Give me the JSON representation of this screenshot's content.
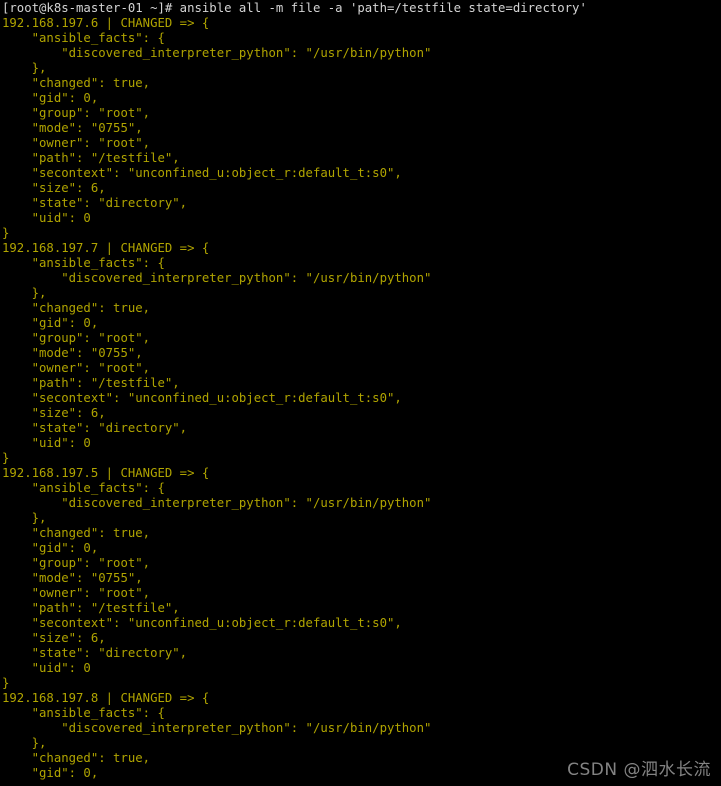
{
  "terminal": {
    "title": "root@k8s-master-01:~",
    "background_color": "#000000",
    "prompt_color": "#d4d4d4",
    "output_color": "#b0a400",
    "prompt_line": "[root@k8s-master-01 ~]# ansible all -m file -a 'path=/testfile state=directory'",
    "prompt": "[root@k8s-master-01 ~]#",
    "command": "ansible all -m file -a 'path=/testfile state=directory'",
    "lines": [
      {
        "text": "[root@k8s-master-01 ~]# ansible all -m file -a 'path=/testfile state=directory'",
        "kind": "prompt"
      },
      {
        "text": "192.168.197.6 | CHANGED => {",
        "kind": "out"
      },
      {
        "text": "    \"ansible_facts\": {",
        "kind": "out"
      },
      {
        "text": "        \"discovered_interpreter_python\": \"/usr/bin/python\"",
        "kind": "out"
      },
      {
        "text": "    },",
        "kind": "out"
      },
      {
        "text": "    \"changed\": true,",
        "kind": "out"
      },
      {
        "text": "    \"gid\": 0,",
        "kind": "out"
      },
      {
        "text": "    \"group\": \"root\",",
        "kind": "out"
      },
      {
        "text": "    \"mode\": \"0755\",",
        "kind": "out"
      },
      {
        "text": "    \"owner\": \"root\",",
        "kind": "out"
      },
      {
        "text": "    \"path\": \"/testfile\",",
        "kind": "out"
      },
      {
        "text": "    \"secontext\": \"unconfined_u:object_r:default_t:s0\",",
        "kind": "out"
      },
      {
        "text": "    \"size\": 6,",
        "kind": "out"
      },
      {
        "text": "    \"state\": \"directory\",",
        "kind": "out"
      },
      {
        "text": "    \"uid\": 0",
        "kind": "out"
      },
      {
        "text": "}",
        "kind": "out"
      },
      {
        "text": "192.168.197.7 | CHANGED => {",
        "kind": "out"
      },
      {
        "text": "    \"ansible_facts\": {",
        "kind": "out"
      },
      {
        "text": "        \"discovered_interpreter_python\": \"/usr/bin/python\"",
        "kind": "out"
      },
      {
        "text": "    },",
        "kind": "out"
      },
      {
        "text": "    \"changed\": true,",
        "kind": "out"
      },
      {
        "text": "    \"gid\": 0,",
        "kind": "out"
      },
      {
        "text": "    \"group\": \"root\",",
        "kind": "out"
      },
      {
        "text": "    \"mode\": \"0755\",",
        "kind": "out"
      },
      {
        "text": "    \"owner\": \"root\",",
        "kind": "out"
      },
      {
        "text": "    \"path\": \"/testfile\",",
        "kind": "out"
      },
      {
        "text": "    \"secontext\": \"unconfined_u:object_r:default_t:s0\",",
        "kind": "out"
      },
      {
        "text": "    \"size\": 6,",
        "kind": "out"
      },
      {
        "text": "    \"state\": \"directory\",",
        "kind": "out"
      },
      {
        "text": "    \"uid\": 0",
        "kind": "out"
      },
      {
        "text": "}",
        "kind": "out"
      },
      {
        "text": "192.168.197.5 | CHANGED => {",
        "kind": "out"
      },
      {
        "text": "    \"ansible_facts\": {",
        "kind": "out"
      },
      {
        "text": "        \"discovered_interpreter_python\": \"/usr/bin/python\"",
        "kind": "out"
      },
      {
        "text": "    },",
        "kind": "out"
      },
      {
        "text": "    \"changed\": true,",
        "kind": "out"
      },
      {
        "text": "    \"gid\": 0,",
        "kind": "out"
      },
      {
        "text": "    \"group\": \"root\",",
        "kind": "out"
      },
      {
        "text": "    \"mode\": \"0755\",",
        "kind": "out"
      },
      {
        "text": "    \"owner\": \"root\",",
        "kind": "out"
      },
      {
        "text": "    \"path\": \"/testfile\",",
        "kind": "out"
      },
      {
        "text": "    \"secontext\": \"unconfined_u:object_r:default_t:s0\",",
        "kind": "out"
      },
      {
        "text": "    \"size\": 6,",
        "kind": "out"
      },
      {
        "text": "    \"state\": \"directory\",",
        "kind": "out"
      },
      {
        "text": "    \"uid\": 0",
        "kind": "out"
      },
      {
        "text": "}",
        "kind": "out"
      },
      {
        "text": "192.168.197.8 | CHANGED => {",
        "kind": "out"
      },
      {
        "text": "    \"ansible_facts\": {",
        "kind": "out"
      },
      {
        "text": "        \"discovered_interpreter_python\": \"/usr/bin/python\"",
        "kind": "out"
      },
      {
        "text": "    },",
        "kind": "out"
      },
      {
        "text": "    \"changed\": true,",
        "kind": "out"
      },
      {
        "text": "    \"gid\": 0,",
        "kind": "out"
      }
    ],
    "hosts": [
      {
        "ip": "192.168.197.6",
        "status": "CHANGED",
        "ansible_facts": {
          "discovered_interpreter_python": "/usr/bin/python"
        },
        "changed": "true",
        "gid": "0",
        "group": "root",
        "mode": "0755",
        "owner": "root",
        "path": "/testfile",
        "secontext": "unconfined_u:object_r:default_t:s0",
        "size": "6",
        "state": "directory",
        "uid": "0"
      },
      {
        "ip": "192.168.197.7",
        "status": "CHANGED",
        "ansible_facts": {
          "discovered_interpreter_python": "/usr/bin/python"
        },
        "changed": "true",
        "gid": "0",
        "group": "root",
        "mode": "0755",
        "owner": "root",
        "path": "/testfile",
        "secontext": "unconfined_u:object_r:default_t:s0",
        "size": "6",
        "state": "directory",
        "uid": "0"
      },
      {
        "ip": "192.168.197.5",
        "status": "CHANGED",
        "ansible_facts": {
          "discovered_interpreter_python": "/usr/bin/python"
        },
        "changed": "true",
        "gid": "0",
        "group": "root",
        "mode": "0755",
        "owner": "root",
        "path": "/testfile",
        "secontext": "unconfined_u:object_r:default_t:s0",
        "size": "6",
        "state": "directory",
        "uid": "0"
      },
      {
        "ip": "192.168.197.8",
        "status": "CHANGED",
        "ansible_facts": {
          "discovered_interpreter_python": "/usr/bin/python"
        },
        "changed": "true",
        "gid": "0",
        "truncated": "true"
      }
    ]
  },
  "watermark": {
    "text": "CSDN @泗水长流",
    "color": "#9a9a9a"
  }
}
